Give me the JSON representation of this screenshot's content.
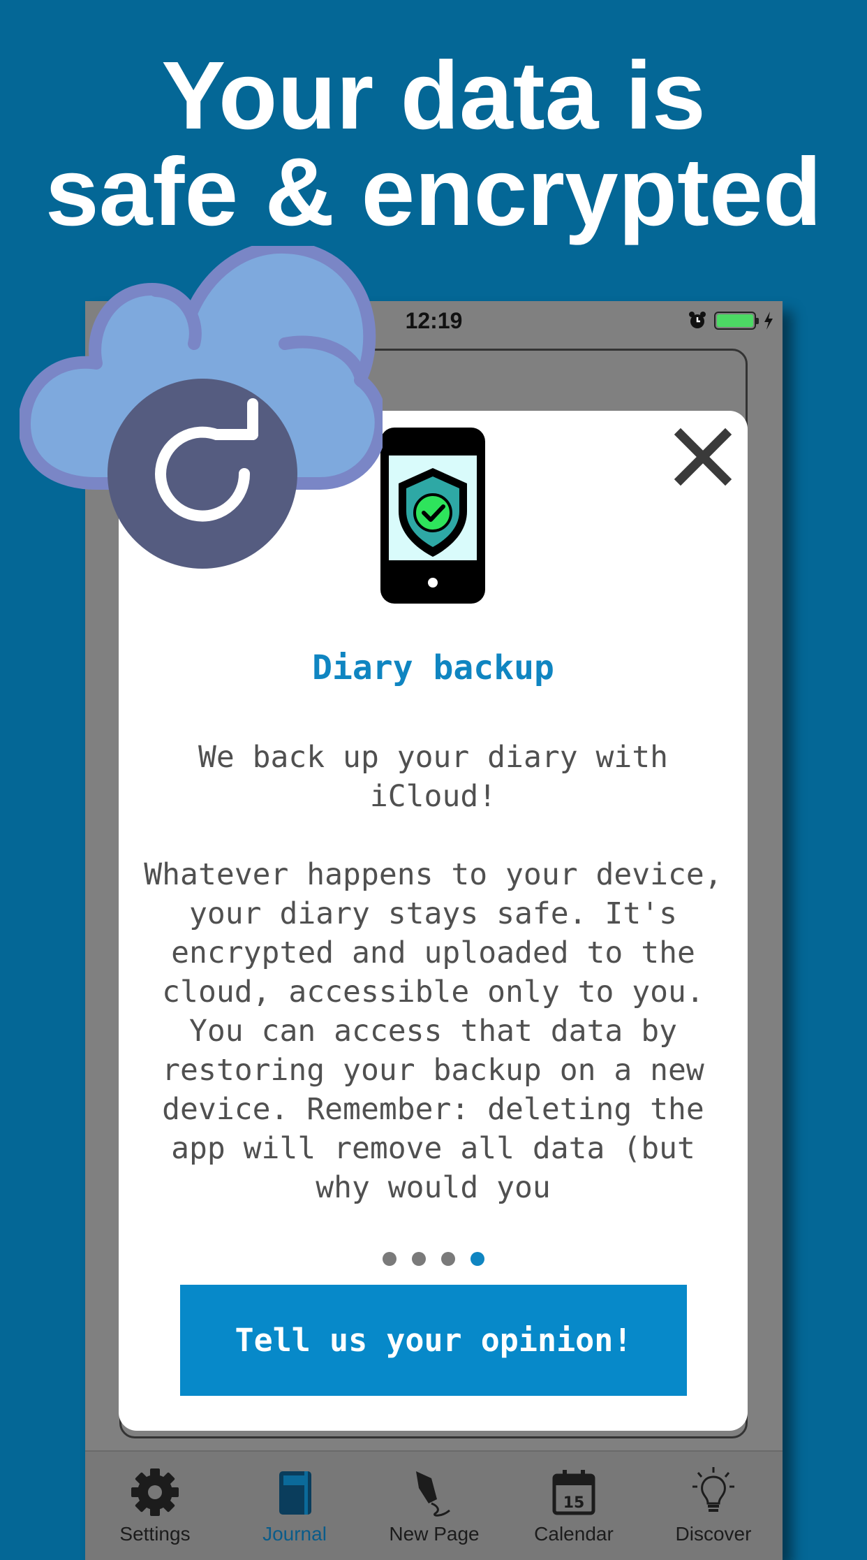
{
  "headline": {
    "line1": "Your data is",
    "line2": "safe & encrypted"
  },
  "status_bar": {
    "time": "12:19",
    "alarm_icon": "alarm-clock-icon",
    "battery_icon": "battery-icon",
    "charging_icon": "charging-bolt-icon"
  },
  "modal": {
    "close_icon": "close-icon",
    "illustration": "phone-shield-check-icon",
    "title": "Diary backup",
    "paragraph1": "We back up your diary with iCloud!",
    "paragraph2": "Whatever happens to your device, your diary stays safe. It's encrypted and uploaded to the cloud, accessible only to you. You can access that data by restoring your backup on a new device. Remember: deleting the app will remove all data (but why would you",
    "page_indicator": {
      "pages": 4,
      "current": 4
    },
    "cta_label": "Tell us your opinion!"
  },
  "tabbar": {
    "items": [
      {
        "label": "Settings",
        "icon": "gear-icon",
        "active": false
      },
      {
        "label": "Journal",
        "icon": "journal-book-icon",
        "active": true
      },
      {
        "label": "New Page",
        "icon": "pen-nib-icon",
        "active": false
      },
      {
        "label": "Calendar",
        "icon": "calendar-icon",
        "date": "15",
        "active": false
      },
      {
        "label": "Discover",
        "icon": "lightbulb-icon",
        "active": false
      }
    ]
  },
  "badge": {
    "icon": "cloud-sync-icon"
  },
  "colors": {
    "background": "#046796",
    "accent": "#0f85c1",
    "button": "#0789c9",
    "cloud": "#7fa9dd",
    "cloud_outline": "#7a86c6",
    "sync_circle": "#555c80"
  }
}
